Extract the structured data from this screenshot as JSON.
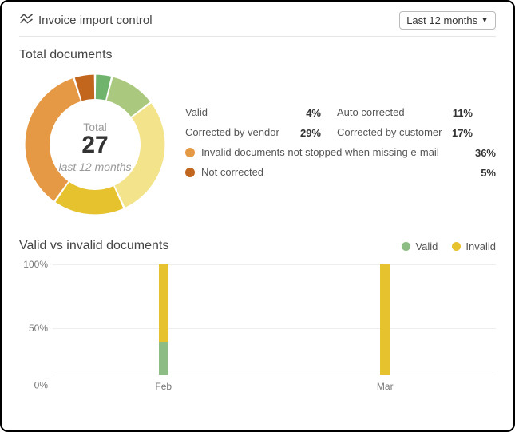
{
  "header": {
    "title": "Invoice import control",
    "range_selected": "Last 12 months"
  },
  "donut": {
    "section_title": "Total documents",
    "center_label": "Total",
    "center_value": "27",
    "center_sub": "last 12 months"
  },
  "legend": {
    "valid": {
      "label": "Valid",
      "pct": "4%",
      "color": "#6fb36c"
    },
    "auto": {
      "label": "Auto corrected",
      "pct": "11%",
      "color": "#aac97f"
    },
    "vendor": {
      "label": "Corrected by vendor",
      "pct": "29%",
      "color": "#f3e38b"
    },
    "customer": {
      "label": "Corrected by customer",
      "pct": "17%",
      "color": "#e7c22f"
    },
    "invalid_nm": {
      "label": "Invalid documents not stopped when missing e-mail",
      "pct": "36%",
      "color": "#e69944"
    },
    "notcorr": {
      "label": "Not corrected",
      "pct": "5%",
      "color": "#c2661d"
    }
  },
  "bar": {
    "title": "Valid vs invalid documents",
    "legend_valid": "Valid",
    "legend_invalid": "Invalid",
    "y_ticks": [
      "0%",
      "50%",
      "100%"
    ]
  },
  "chart_data": [
    {
      "type": "pie",
      "title": "Total documents",
      "series": [
        {
          "name": "Valid",
          "value": 4,
          "color": "#6fb36c"
        },
        {
          "name": "Auto corrected",
          "value": 11,
          "color": "#aac97f"
        },
        {
          "name": "Corrected by vendor",
          "value": 29,
          "color": "#f3e38b"
        },
        {
          "name": "Corrected by customer",
          "value": 17,
          "color": "#e7c22f"
        },
        {
          "name": "Invalid documents not stopped when missing e-mail",
          "value": 36,
          "color": "#e69944"
        },
        {
          "name": "Not corrected",
          "value": 5,
          "color": "#c2661d"
        }
      ],
      "total_label": "Total",
      "total_value": 27,
      "subtitle": "last 12 months"
    },
    {
      "type": "bar",
      "title": "Valid vs invalid documents",
      "categories": [
        "Feb",
        "Mar"
      ],
      "series": [
        {
          "name": "Valid",
          "color": "#8dbc84",
          "values": [
            30,
            0
          ]
        },
        {
          "name": "Invalid",
          "color": "#e7c22f",
          "values": [
            70,
            100
          ]
        }
      ],
      "stacked": true,
      "ylim": [
        0,
        100
      ],
      "ylabel": "",
      "y_ticks": [
        0,
        50,
        100
      ]
    }
  ]
}
